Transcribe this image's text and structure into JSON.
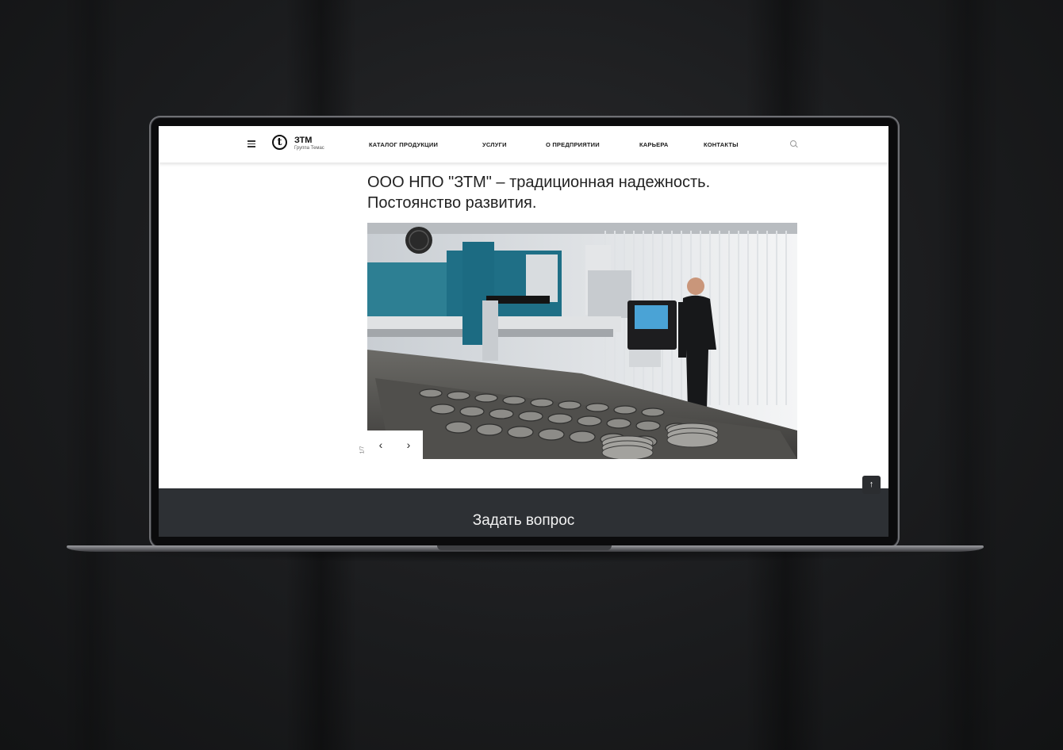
{
  "logo": {
    "mark": "t",
    "name": "ЗТМ",
    "subtitle": "Группа Темас"
  },
  "nav": [
    {
      "label": "КАТАЛОГ ПРОДУКЦИИ"
    },
    {
      "label": "УСЛУГИ"
    },
    {
      "label": "О ПРЕДПРИЯТИИ"
    },
    {
      "label": "КАРЬЕРА"
    },
    {
      "label": "КОНТАКТЫ"
    }
  ],
  "icons": {
    "menu": "hamburger-icon",
    "search": "search-icon",
    "prev": "chevron-left-icon",
    "next": "chevron-right-icon",
    "top": "arrow-up-icon"
  },
  "hero": {
    "title_line1": "ООО НПО \"ЗТМ\" – традиционная надежность.",
    "title_line2": "Постоянство развития.",
    "slide_counter": "1/7",
    "prev_glyph": "‹",
    "next_glyph": "›"
  },
  "scroll_top_glyph": "↑",
  "footer": {
    "ask_label": "Задать вопрос"
  },
  "colors": {
    "footer_bg": "#2d3034",
    "accent_machine": "#1f6f86"
  }
}
